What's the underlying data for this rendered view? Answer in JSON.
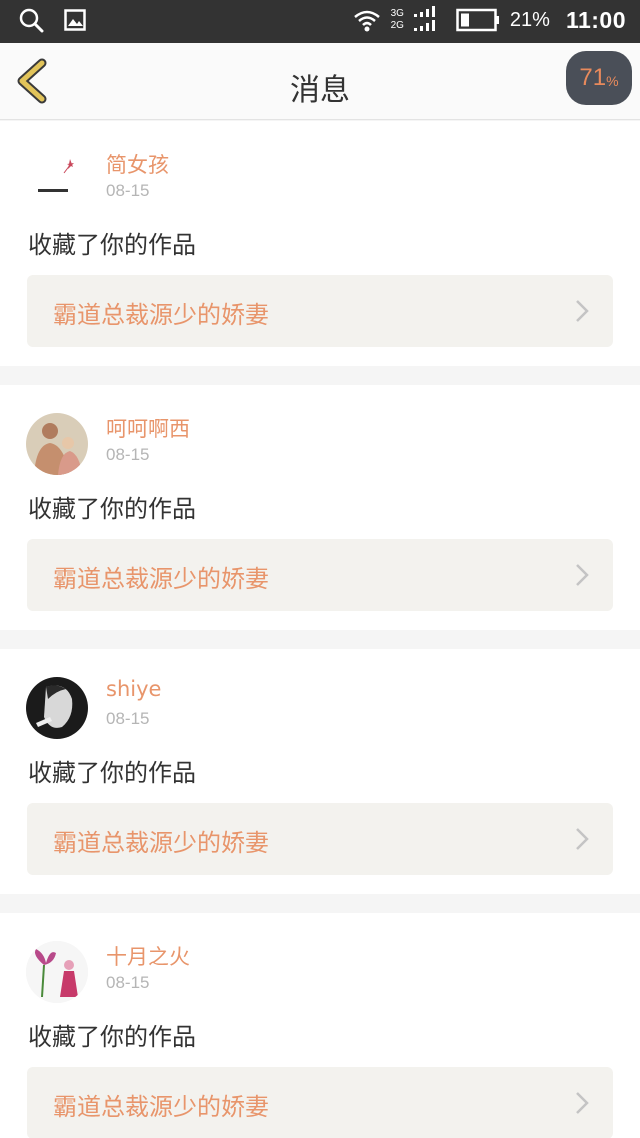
{
  "status_bar": {
    "net_top": "3G",
    "net_bottom": "2G",
    "battery": "21%",
    "time": "11:00",
    "icons": [
      "search-icon",
      "image-icon",
      "wifi-icon",
      "signal-icon",
      "battery-icon"
    ]
  },
  "header": {
    "title": "消息",
    "badge_number": "71",
    "badge_unit": "%"
  },
  "messages": [
    {
      "user": "简女孩",
      "date": "08-15",
      "action": "收藏了你的作品",
      "work": "霸道总裁源少的娇妻"
    },
    {
      "user": "呵呵啊西",
      "date": "08-15",
      "action": "收藏了你的作品",
      "work": "霸道总裁源少的娇妻"
    },
    {
      "user": "shiye",
      "date": "08-15",
      "action": "收藏了你的作品",
      "work": "霸道总裁源少的娇妻"
    },
    {
      "user": "十月之火",
      "date": "08-15",
      "action": "收藏了你的作品",
      "work": "霸道总裁源少的娇妻"
    }
  ],
  "colors": {
    "accent": "#e8956b",
    "status_bar": "#333333",
    "card_inner": "#f3f2ee",
    "back_arrow": "#e2c45a"
  }
}
